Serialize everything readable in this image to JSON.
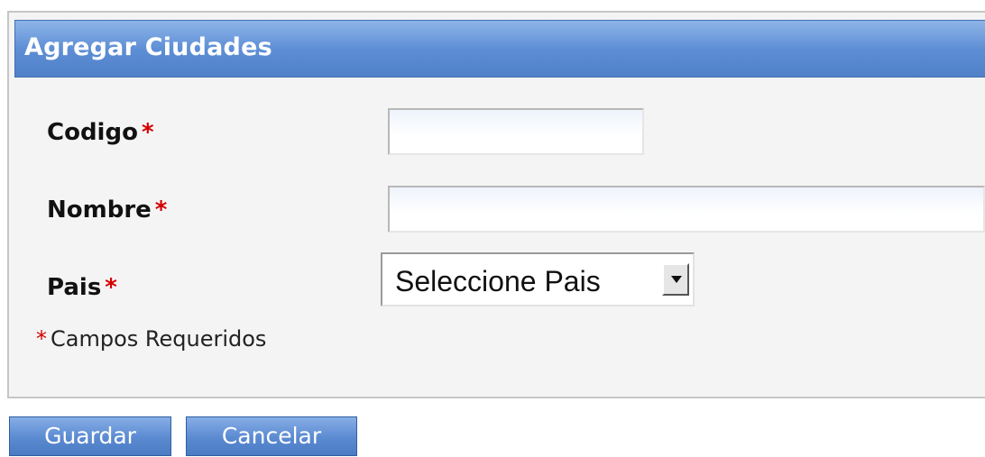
{
  "panel": {
    "title": "Agregar Ciudades"
  },
  "form": {
    "codigo": {
      "label": "Codigo",
      "required_mark": "*",
      "value": ""
    },
    "nombre": {
      "label": "Nombre",
      "required_mark": "*",
      "value": ""
    },
    "pais": {
      "label": "Pais",
      "required_mark": "*",
      "selected": "Seleccione Pais"
    },
    "required_note": {
      "mark": "*",
      "text": "Campos Requeridos"
    }
  },
  "buttons": {
    "save_label": "Guardar",
    "cancel_label": "Cancelar"
  },
  "colors": {
    "header_blue": "#5e8fd6",
    "required_red": "#d40000",
    "button_blue": "#5b8ad1"
  },
  "icons": {
    "select_arrow": "chevron-down-icon"
  }
}
